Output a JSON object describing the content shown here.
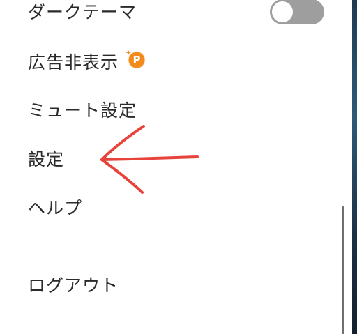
{
  "menu": {
    "dark_theme_label": "ダークテーマ",
    "dark_theme_enabled": false,
    "hide_ads_label": "広告非表示",
    "premium_badge_letter": "P",
    "mute_settings_label": "ミュート設定",
    "settings_label": "設定",
    "help_label": "ヘルプ",
    "logout_label": "ログアウト"
  },
  "colors": {
    "annotation_arrow": "#e8433a",
    "toggle_off": "#9e9e9e",
    "badge_orange": "#f28a1c"
  },
  "icons": {
    "premium": "premium-p-icon"
  }
}
